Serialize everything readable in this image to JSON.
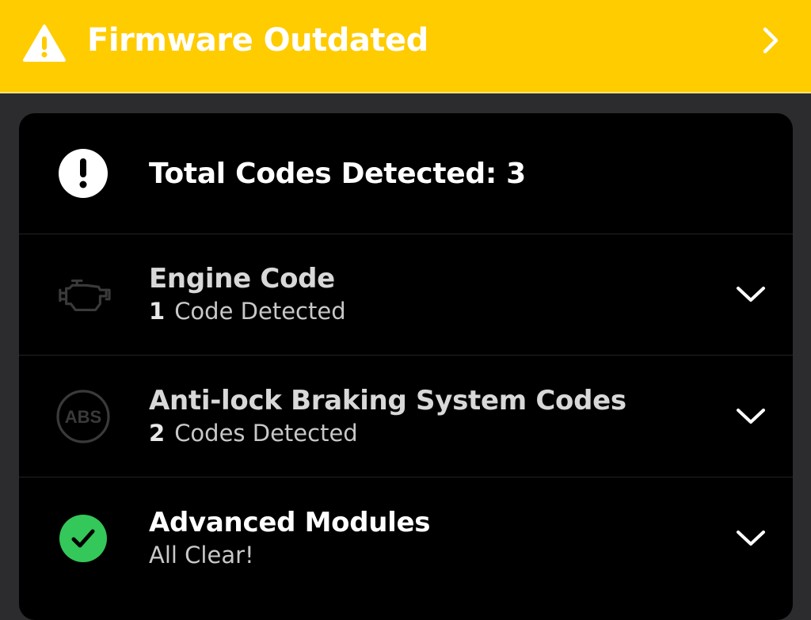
{
  "banner": {
    "title": "Firmware Outdated",
    "icon": "warning-triangle-icon",
    "chevron_icon": "chevron-right-icon",
    "background_color": "#ffcc00"
  },
  "summary": {
    "title": "Total Codes Detected: 3",
    "icon": "exclamation-circle-icon"
  },
  "sections": [
    {
      "title": "Engine Code",
      "count": "1",
      "subtitle": "Code Detected",
      "icon": "engine-icon",
      "chevron_icon": "chevron-down-icon"
    },
    {
      "title": "Anti-lock Braking System Codes",
      "count": "2",
      "subtitle": "Codes Detected",
      "icon": "abs-icon",
      "icon_text": "ABS",
      "chevron_icon": "chevron-down-icon"
    },
    {
      "title": "Advanced Modules",
      "subtitle": "All Clear!",
      "icon": "check-circle-icon",
      "icon_color": "#34c759",
      "chevron_icon": "chevron-down-icon"
    }
  ]
}
